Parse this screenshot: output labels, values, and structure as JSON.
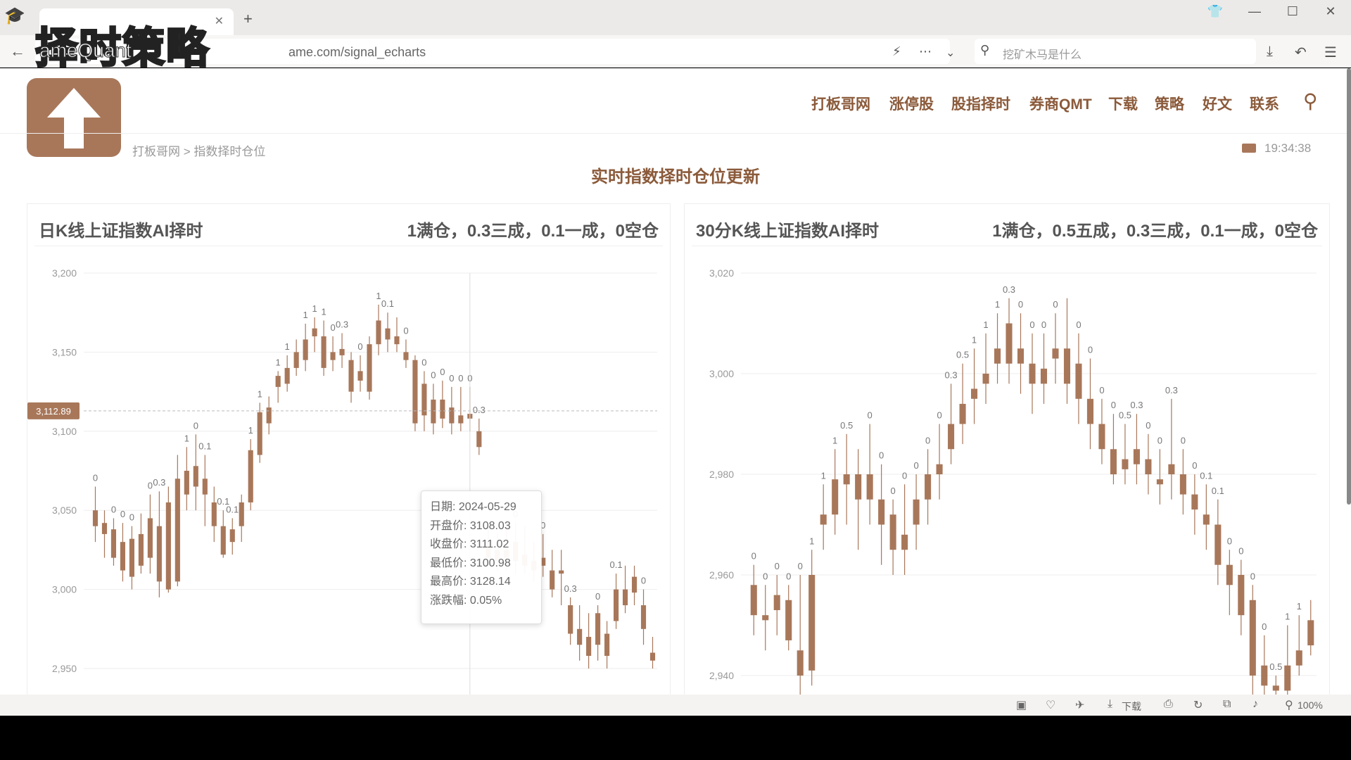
{
  "browser": {
    "tab_title": "实时指数择时仓位更新",
    "url": "ame.com/signal_echarts",
    "search_placeholder": "挖矿木马是什么",
    "zoom": "100%",
    "download_label": "下载"
  },
  "overlay": {
    "title": "择时策略",
    "sub": "ameQuant"
  },
  "site": {
    "nav": [
      "打板哥网",
      "涨停股",
      "股指择时",
      "券商QMT",
      "下载",
      "策略",
      "好文",
      "联系"
    ],
    "breadcrumb": "打板哥网 > 指数择时仓位",
    "time": "19:34:38",
    "page_title": "实时指数择时仓位更新"
  },
  "panels": {
    "left": {
      "title": "日K线上证指数AI择时",
      "legend": "1满仓，0.3三成，0.1一成，0空仓"
    },
    "right": {
      "title": "30分K线上证指数AI择时",
      "legend": "1满仓，0.5五成，0.3三成，0.1一成，0空仓"
    }
  },
  "tooltip": {
    "date": "日期: 2024-05-29",
    "open": "开盘价: 3108.03",
    "close": "收盘价: 3111.02",
    "low": "最低价: 3100.98",
    "high": "最高价: 3128.14",
    "change": "涨跌幅: 0.05%"
  },
  "colors": {
    "brand": "#a8775a",
    "candle": "#a8775a",
    "nav": "#8b5a3a"
  },
  "chart_data": [
    {
      "type": "candlestick",
      "title": "日K线上证指数AI择时",
      "ylim": [
        2950,
        3200
      ],
      "yticks": [
        3200,
        3150,
        3100,
        3050,
        3000,
        2950
      ],
      "crosshair_value": "3,112.89",
      "candles": [
        [
          3050,
          3040,
          3065,
          3030,
          "0"
        ],
        [
          3042,
          3035,
          3050,
          3020,
          ""
        ],
        [
          3038,
          3020,
          3045,
          3015,
          "0"
        ],
        [
          3030,
          3012,
          3042,
          3005,
          "0"
        ],
        [
          3032,
          3008,
          3040,
          3000,
          "0"
        ],
        [
          3035,
          3015,
          3048,
          3010,
          ""
        ],
        [
          3045,
          3020,
          3060,
          3010,
          "0"
        ],
        [
          3040,
          3005,
          3062,
          2995,
          "0.3"
        ],
        [
          3055,
          3000,
          3065,
          2998,
          ""
        ],
        [
          3070,
          3005,
          3085,
          3002,
          ""
        ],
        [
          3060,
          3075,
          3090,
          3050,
          "1"
        ],
        [
          3078,
          3065,
          3098,
          3050,
          "0"
        ],
        [
          3070,
          3060,
          3085,
          3040,
          "0.1"
        ],
        [
          3040,
          3055,
          3065,
          3030,
          ""
        ],
        [
          3022,
          3040,
          3050,
          3020,
          "0.1"
        ],
        [
          3030,
          3038,
          3045,
          3022,
          "0.1"
        ],
        [
          3040,
          3055,
          3060,
          3030,
          ""
        ],
        [
          3055,
          3088,
          3095,
          3050,
          "1"
        ],
        [
          3085,
          3112,
          3118,
          3080,
          "1"
        ],
        [
          3105,
          3115,
          3122,
          3098,
          ""
        ],
        [
          3128,
          3135,
          3138,
          3118,
          "1"
        ],
        [
          3130,
          3140,
          3148,
          3125,
          "1"
        ],
        [
          3140,
          3150,
          3158,
          3135,
          ""
        ],
        [
          3145,
          3158,
          3168,
          3138,
          "1"
        ],
        [
          3160,
          3165,
          3172,
          3150,
          "1"
        ],
        [
          3140,
          3160,
          3170,
          3135,
          "1"
        ],
        [
          3150,
          3145,
          3160,
          3138,
          "0"
        ],
        [
          3148,
          3152,
          3162,
          3140,
          "0.3"
        ],
        [
          3125,
          3145,
          3150,
          3118,
          ""
        ],
        [
          3138,
          3132,
          3148,
          3125,
          "0"
        ],
        [
          3125,
          3155,
          3160,
          3120,
          ""
        ],
        [
          3155,
          3170,
          3180,
          3148,
          "1"
        ],
        [
          3165,
          3158,
          3175,
          3150,
          "0.1"
        ],
        [
          3160,
          3155,
          3172,
          3150,
          ""
        ],
        [
          3150,
          3145,
          3158,
          3140,
          "0"
        ],
        [
          3105,
          3145,
          3148,
          3100,
          ""
        ],
        [
          3110,
          3130,
          3138,
          3100,
          "0"
        ],
        [
          3120,
          3105,
          3130,
          3098,
          "0"
        ],
        [
          3108,
          3120,
          3132,
          3102,
          "0"
        ],
        [
          3105,
          3115,
          3128,
          3098,
          "0"
        ],
        [
          3110,
          3105,
          3128,
          3100,
          "0"
        ],
        [
          3108,
          3111,
          3128,
          3100,
          "0"
        ],
        [
          3090,
          3100,
          3108,
          3085,
          "0.3"
        ],
        [
          3030,
          3020,
          3040,
          3015,
          ""
        ],
        [
          3025,
          3018,
          3035,
          3012,
          ""
        ],
        [
          3025,
          3020,
          3040,
          3012,
          ""
        ],
        [
          3030,
          3018,
          3042,
          3010,
          "0"
        ],
        [
          3022,
          3015,
          3040,
          3010,
          ""
        ],
        [
          3018,
          3012,
          3030,
          3005,
          ""
        ],
        [
          3020,
          3015,
          3035,
          3008,
          "0"
        ],
        [
          3012,
          3000,
          3025,
          2995,
          ""
        ],
        [
          3010,
          3012,
          3025,
          2990,
          ""
        ],
        [
          2990,
          2972,
          2995,
          2965,
          "0.3"
        ],
        [
          2975,
          2965,
          2990,
          2955,
          ""
        ],
        [
          2970,
          2958,
          2985,
          2950,
          ""
        ],
        [
          2965,
          2985,
          2990,
          2955,
          "0"
        ],
        [
          2972,
          2958,
          2980,
          2950,
          ""
        ],
        [
          2980,
          3000,
          3010,
          2975,
          "0.1"
        ],
        [
          3000,
          2990,
          3015,
          2985,
          ""
        ],
        [
          2998,
          3008,
          3015,
          2990,
          ""
        ],
        [
          2990,
          2975,
          3000,
          2965,
          "0"
        ],
        [
          2960,
          2955,
          2970,
          2950,
          ""
        ]
      ]
    },
    {
      "type": "candlestick",
      "title": "30分K线上证指数AI择时",
      "ylim": [
        2935,
        3020
      ],
      "yticks": [
        3020,
        3000,
        2980,
        2960,
        2940
      ],
      "candles": [
        [
          2958,
          2952,
          2962,
          2948,
          "0"
        ],
        [
          2952,
          2951,
          2958,
          2945,
          "0"
        ],
        [
          2956,
          2953,
          2960,
          2948,
          "0"
        ],
        [
          2955,
          2947,
          2958,
          2945,
          "0"
        ],
        [
          2945,
          2940,
          2960,
          2935,
          "0"
        ],
        [
          2941,
          2960,
          2965,
          2938,
          "1"
        ],
        [
          2972,
          2970,
          2978,
          2965,
          "1"
        ],
        [
          2972,
          2979,
          2985,
          2968,
          "1"
        ],
        [
          2978,
          2980,
          2988,
          2970,
          "0.5"
        ],
        [
          2980,
          2975,
          2985,
          2965,
          ""
        ],
        [
          2980,
          2975,
          2990,
          2970,
          "0"
        ],
        [
          2975,
          2970,
          2982,
          2962,
          "0"
        ],
        [
          2972,
          2965,
          2975,
          2960,
          "0"
        ],
        [
          2965,
          2968,
          2978,
          2960,
          "0"
        ],
        [
          2970,
          2975,
          2980,
          2965,
          "0"
        ],
        [
          2975,
          2980,
          2985,
          2970,
          "0"
        ],
        [
          2980,
          2982,
          2990,
          2975,
          "0"
        ],
        [
          2985,
          2990,
          2998,
          2982,
          "0.3"
        ],
        [
          2990,
          2994,
          3002,
          2986,
          "0.5"
        ],
        [
          2995,
          2997,
          3005,
          2990,
          "1"
        ],
        [
          2998,
          3000,
          3008,
          2994,
          "1"
        ],
        [
          3002,
          3005,
          3012,
          2998,
          "1"
        ],
        [
          3010,
          3002,
          3015,
          2998,
          "0.3"
        ],
        [
          3005,
          3002,
          3012,
          2996,
          "0"
        ],
        [
          3002,
          2998,
          3008,
          2992,
          "0"
        ],
        [
          2998,
          3001,
          3008,
          2994,
          "0"
        ],
        [
          3003,
          3005,
          3012,
          2998,
          "0"
        ],
        [
          3005,
          2998,
          3015,
          2994,
          ""
        ],
        [
          3002,
          2995,
          3008,
          2990,
          "0"
        ],
        [
          2995,
          2990,
          3003,
          2985,
          "0"
        ],
        [
          2990,
          2985,
          2995,
          2982,
          "0"
        ],
        [
          2985,
          2980,
          2992,
          2978,
          "0"
        ],
        [
          2983,
          2981,
          2990,
          2978,
          "0.5"
        ],
        [
          2985,
          2982,
          2992,
          2978,
          "0.3"
        ],
        [
          2983,
          2980,
          2988,
          2976,
          "0"
        ],
        [
          2978,
          2979,
          2985,
          2974,
          "0"
        ],
        [
          2982,
          2980,
          2995,
          2975,
          "0.3"
        ],
        [
          2980,
          2976,
          2985,
          2972,
          "0"
        ],
        [
          2976,
          2973,
          2980,
          2968,
          "0"
        ],
        [
          2972,
          2970,
          2978,
          2965,
          "0.1"
        ],
        [
          2970,
          2962,
          2975,
          2958,
          "0.1"
        ],
        [
          2962,
          2958,
          2965,
          2952,
          "0"
        ],
        [
          2960,
          2952,
          2963,
          2948,
          "0"
        ],
        [
          2955,
          2940,
          2958,
          2935,
          "0"
        ],
        [
          2942,
          2938,
          2948,
          2935,
          "0"
        ],
        [
          2938,
          2937,
          2940,
          2935,
          "0.5"
        ],
        [
          2937,
          2942,
          2950,
          2935,
          "1"
        ],
        [
          2942,
          2945,
          2952,
          2940,
          "1"
        ],
        [
          2946,
          2951,
          2955,
          2944,
          ""
        ]
      ]
    }
  ]
}
